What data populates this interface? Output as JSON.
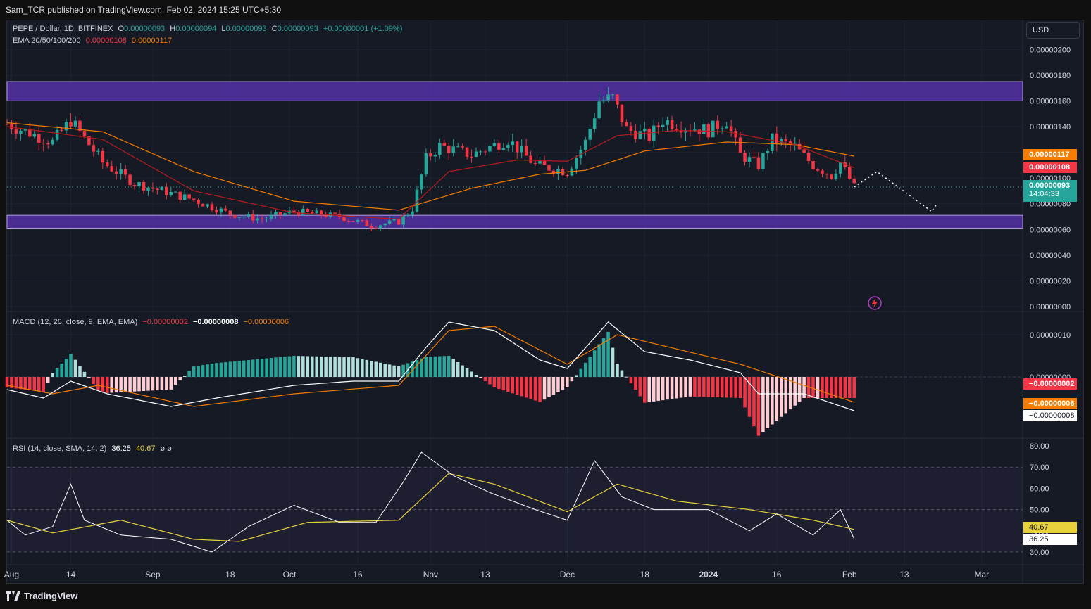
{
  "header": {
    "publisher": "Sam_TCR published on TradingView.com, Feb 02, 2024 15:25 UTC+5:30"
  },
  "footer": {
    "brand": "TradingView"
  },
  "toolbar": {
    "currency": "USD"
  },
  "legend": {
    "symbol": "PEPE / Dollar, 1D, BITFINEX",
    "o_label": "O",
    "o_value": "0.00000093",
    "h_label": "H",
    "h_value": "0.00000094",
    "l_label": "L",
    "l_value": "0.00000093",
    "c_label": "C",
    "c_value": "0.00000093",
    "change": "+0.00000001 (+1.09%)",
    "ema_label": "EMA 20/50/100/200",
    "ema_value_1": "0.00000108",
    "ema_value_2": "0.00000117",
    "macd_label": "MACD (12, 26, close, 9, EMA, EMA)",
    "macd_hist": "−0.00000002",
    "macd_line": "−0.00000008",
    "macd_signal": "−0.00000006",
    "rsi_label": "RSI (14, close, SMA, 14, 2)",
    "rsi_value": "36.25",
    "rsi_ma": "40.67",
    "rsi_extra": "ø  ø"
  },
  "price_tags": {
    "ema_slow": "0.00000117",
    "ema_fast": "0.00000108",
    "last": "0.00000093",
    "countdown": "14:04:33",
    "macd_hist": "−0.00000002",
    "macd_signal": "−0.00000006",
    "macd_line": "−0.00000008",
    "rsi_ma": "40.67",
    "rsi_value": "36.25"
  },
  "colors": {
    "up": "#26a69a",
    "down": "#f23645",
    "zone": "#5b34b8",
    "ema_fast": "#b71c1c",
    "ema_slow": "#f57c00",
    "macd": "#ffffff",
    "signal": "#f57c00",
    "rsi": "#ffffff",
    "rsi_ma": "#e8d23c"
  },
  "chart_data": [
    {
      "type": "candlestick",
      "title": "PEPE / Dollar, 1D, BITFINEX",
      "y_unit": "USD",
      "ylim": [
        0,
        2.1e-06
      ],
      "y_ticks": [
        "0.00000200",
        "0.00000180",
        "0.00000160",
        "0.00000140",
        "0.00000120",
        "0.00000100",
        "0.00000080",
        "0.00000060",
        "0.00000040",
        "0.00000020",
        "0.00000000"
      ],
      "x_ticks": [
        "Aug",
        "14",
        "Sep",
        "18",
        "Oct",
        "16",
        "Nov",
        "13",
        "Dec",
        "18",
        "2024",
        "16",
        "Feb",
        "13",
        "Mar"
      ],
      "x_range": [
        "2023-07-31",
        "2024-03-10"
      ],
      "close_key_points": [
        {
          "date": "2023-07-31",
          "close": 1.42e-06
        },
        {
          "date": "2023-08-10",
          "close": 1.28e-06
        },
        {
          "date": "2023-08-14",
          "close": 1.45e-06
        },
        {
          "date": "2023-08-21",
          "close": 1.12e-06
        },
        {
          "date": "2023-08-28",
          "close": 9.6e-07
        },
        {
          "date": "2023-09-10",
          "close": 8.3e-07
        },
        {
          "date": "2023-09-18",
          "close": 7.2e-07
        },
        {
          "date": "2023-09-25",
          "close": 6.8e-07
        },
        {
          "date": "2023-10-02",
          "close": 7.4e-07
        },
        {
          "date": "2023-10-12",
          "close": 7e-07
        },
        {
          "date": "2023-10-19",
          "close": 6.3e-07
        },
        {
          "date": "2023-10-25",
          "close": 6.6e-07
        },
        {
          "date": "2023-10-28",
          "close": 7.6e-07
        },
        {
          "date": "2023-10-31",
          "close": 1.15e-06
        },
        {
          "date": "2023-11-03",
          "close": 1.25e-06
        },
        {
          "date": "2023-11-10",
          "close": 1.18e-06
        },
        {
          "date": "2023-11-18",
          "close": 1.3e-06
        },
        {
          "date": "2023-11-24",
          "close": 1.1e-06
        },
        {
          "date": "2023-12-01",
          "close": 1.05e-06
        },
        {
          "date": "2023-12-05",
          "close": 1.28e-06
        },
        {
          "date": "2023-12-08",
          "close": 1.6e-06
        },
        {
          "date": "2023-12-11",
          "close": 1.62e-06
        },
        {
          "date": "2023-12-14",
          "close": 1.38e-06
        },
        {
          "date": "2023-12-19",
          "close": 1.32e-06
        },
        {
          "date": "2023-12-22",
          "close": 1.45e-06
        },
        {
          "date": "2023-12-27",
          "close": 1.4e-06
        },
        {
          "date": "2024-01-01",
          "close": 1.37e-06
        },
        {
          "date": "2024-01-05",
          "close": 1.45e-06
        },
        {
          "date": "2024-01-08",
          "close": 1.18e-06
        },
        {
          "date": "2024-01-12",
          "close": 1.1e-06
        },
        {
          "date": "2024-01-15",
          "close": 1.3e-06
        },
        {
          "date": "2024-01-20",
          "close": 1.24e-06
        },
        {
          "date": "2024-01-24",
          "close": 1.1e-06
        },
        {
          "date": "2024-01-28",
          "close": 1.02e-06
        },
        {
          "date": "2024-01-30",
          "close": 1.12e-06
        },
        {
          "date": "2024-02-02",
          "close": 9.3e-07
        }
      ],
      "ema_fast_key_points": [
        {
          "date": "2023-07-31",
          "value": 1.4e-06
        },
        {
          "date": "2023-08-21",
          "value": 1.3e-06
        },
        {
          "date": "2023-09-10",
          "value": 9e-07
        },
        {
          "date": "2023-10-02",
          "value": 7.3e-07
        },
        {
          "date": "2023-10-25",
          "value": 6.8e-07
        },
        {
          "date": "2023-11-05",
          "value": 1.05e-06
        },
        {
          "date": "2023-11-20",
          "value": 1.14e-06
        },
        {
          "date": "2023-12-01",
          "value": 1.13e-06
        },
        {
          "date": "2023-12-12",
          "value": 1.33e-06
        },
        {
          "date": "2023-12-25",
          "value": 1.37e-06
        },
        {
          "date": "2024-01-05",
          "value": 1.36e-06
        },
        {
          "date": "2024-01-20",
          "value": 1.26e-06
        },
        {
          "date": "2024-02-02",
          "value": 1.08e-06
        }
      ],
      "ema_slow_key_points": [
        {
          "date": "2023-07-31",
          "value": 1.43e-06
        },
        {
          "date": "2023-08-21",
          "value": 1.36e-06
        },
        {
          "date": "2023-09-10",
          "value": 1.05e-06
        },
        {
          "date": "2023-10-02",
          "value": 8.2e-07
        },
        {
          "date": "2023-10-25",
          "value": 7.5e-07
        },
        {
          "date": "2023-11-10",
          "value": 9.2e-07
        },
        {
          "date": "2023-11-25",
          "value": 1.03e-06
        },
        {
          "date": "2023-12-05",
          "value": 1.06e-06
        },
        {
          "date": "2023-12-18",
          "value": 1.21e-06
        },
        {
          "date": "2024-01-05",
          "value": 1.28e-06
        },
        {
          "date": "2024-01-20",
          "value": 1.26e-06
        },
        {
          "date": "2024-02-02",
          "value": 1.17e-06
        }
      ],
      "resistance_zone": [
        1.6e-06,
        1.75e-06
      ],
      "support_zone": [
        6.1e-07,
        7.1e-07
      ],
      "projection_path": [
        {
          "date": "2024-02-02",
          "value": 9.3e-07
        },
        {
          "date": "2024-02-07",
          "value": 1.05e-06
        },
        {
          "date": "2024-02-19",
          "value": 7.4e-07
        },
        {
          "date": "2024-02-20",
          "value": 7.9e-07
        }
      ]
    },
    {
      "type": "macd",
      "title": "MACD (12, 26, close, 9, EMA, EMA)",
      "y_ticks": [
        "0.00000010",
        "0.00000000"
      ],
      "macd_key_points": [
        {
          "date": "2023-07-31",
          "value": -3e-08
        },
        {
          "date": "2023-08-08",
          "value": -5e-08
        },
        {
          "date": "2023-08-14",
          "value": -1e-08
        },
        {
          "date": "2023-08-22",
          "value": -4e-08
        },
        {
          "date": "2023-09-05",
          "value": -7e-08
        },
        {
          "date": "2023-09-15",
          "value": -5e-08
        },
        {
          "date": "2023-10-02",
          "value": -2e-08
        },
        {
          "date": "2023-10-15",
          "value": -1e-08
        },
        {
          "date": "2023-10-25",
          "value": -1e-08
        },
        {
          "date": "2023-10-31",
          "value": 7e-08
        },
        {
          "date": "2023-11-05",
          "value": 1.3e-07
        },
        {
          "date": "2023-11-15",
          "value": 1.1e-07
        },
        {
          "date": "2023-11-25",
          "value": 4e-08
        },
        {
          "date": "2023-12-01",
          "value": 2e-08
        },
        {
          "date": "2023-12-10",
          "value": 1.3e-07
        },
        {
          "date": "2023-12-18",
          "value": 6e-08
        },
        {
          "date": "2023-12-28",
          "value": 4e-08
        },
        {
          "date": "2024-01-08",
          "value": 1e-08
        },
        {
          "date": "2024-01-12",
          "value": -4e-08
        },
        {
          "date": "2024-01-22",
          "value": -4e-08
        },
        {
          "date": "2024-02-02",
          "value": -8e-08
        }
      ],
      "signal_key_points": [
        {
          "date": "2023-07-31",
          "value": -2e-08
        },
        {
          "date": "2023-08-10",
          "value": -4e-08
        },
        {
          "date": "2023-08-20",
          "value": -2e-08
        },
        {
          "date": "2023-09-10",
          "value": -7e-08
        },
        {
          "date": "2023-10-02",
          "value": -4e-08
        },
        {
          "date": "2023-10-25",
          "value": -2e-08
        },
        {
          "date": "2023-11-05",
          "value": 1.1e-07
        },
        {
          "date": "2023-11-15",
          "value": 1.2e-07
        },
        {
          "date": "2023-12-01",
          "value": 3e-08
        },
        {
          "date": "2023-12-12",
          "value": 1e-07
        },
        {
          "date": "2024-01-08",
          "value": 3e-08
        },
        {
          "date": "2024-01-22",
          "value": -2e-08
        },
        {
          "date": "2024-02-02",
          "value": -6e-08
        }
      ]
    },
    {
      "type": "rsi",
      "title": "RSI (14, close, SMA, 14, 2)",
      "ylim": [
        28,
        82
      ],
      "y_ticks": [
        "80.00",
        "70.00",
        "60.00",
        "50.00",
        "40.00",
        "30.00"
      ],
      "bands": [
        30,
        50,
        70
      ],
      "rsi_key_points": [
        {
          "date": "2023-07-31",
          "value": 45
        },
        {
          "date": "2023-08-04",
          "value": 38
        },
        {
          "date": "2023-08-10",
          "value": 42
        },
        {
          "date": "2023-08-14",
          "value": 62
        },
        {
          "date": "2023-08-17",
          "value": 45
        },
        {
          "date": "2023-08-25",
          "value": 38
        },
        {
          "date": "2023-09-05",
          "value": 36
        },
        {
          "date": "2023-09-14",
          "value": 30
        },
        {
          "date": "2023-09-22",
          "value": 42
        },
        {
          "date": "2023-10-02",
          "value": 52
        },
        {
          "date": "2023-10-12",
          "value": 44
        },
        {
          "date": "2023-10-20",
          "value": 44
        },
        {
          "date": "2023-10-26",
          "value": 63
        },
        {
          "date": "2023-10-30",
          "value": 77
        },
        {
          "date": "2023-11-06",
          "value": 66
        },
        {
          "date": "2023-11-14",
          "value": 58
        },
        {
          "date": "2023-11-24",
          "value": 50
        },
        {
          "date": "2023-12-01",
          "value": 45
        },
        {
          "date": "2023-12-07",
          "value": 73
        },
        {
          "date": "2023-12-13",
          "value": 56
        },
        {
          "date": "2023-12-20",
          "value": 50
        },
        {
          "date": "2024-01-01",
          "value": 50
        },
        {
          "date": "2024-01-10",
          "value": 40
        },
        {
          "date": "2024-01-16",
          "value": 48
        },
        {
          "date": "2024-01-24",
          "value": 38
        },
        {
          "date": "2024-01-30",
          "value": 50
        },
        {
          "date": "2024-02-02",
          "value": 36.25
        }
      ],
      "rsi_ma_key_points": [
        {
          "date": "2023-07-31",
          "value": 45
        },
        {
          "date": "2023-08-10",
          "value": 39
        },
        {
          "date": "2023-08-25",
          "value": 45
        },
        {
          "date": "2023-09-10",
          "value": 36
        },
        {
          "date": "2023-09-20",
          "value": 35
        },
        {
          "date": "2023-10-05",
          "value": 44
        },
        {
          "date": "2023-10-25",
          "value": 45
        },
        {
          "date": "2023-11-05",
          "value": 67
        },
        {
          "date": "2023-11-15",
          "value": 62
        },
        {
          "date": "2023-12-01",
          "value": 49
        },
        {
          "date": "2023-12-12",
          "value": 62
        },
        {
          "date": "2023-12-25",
          "value": 54
        },
        {
          "date": "2024-01-10",
          "value": 50
        },
        {
          "date": "2024-01-24",
          "value": 45
        },
        {
          "date": "2024-02-02",
          "value": 40.67
        }
      ]
    }
  ]
}
